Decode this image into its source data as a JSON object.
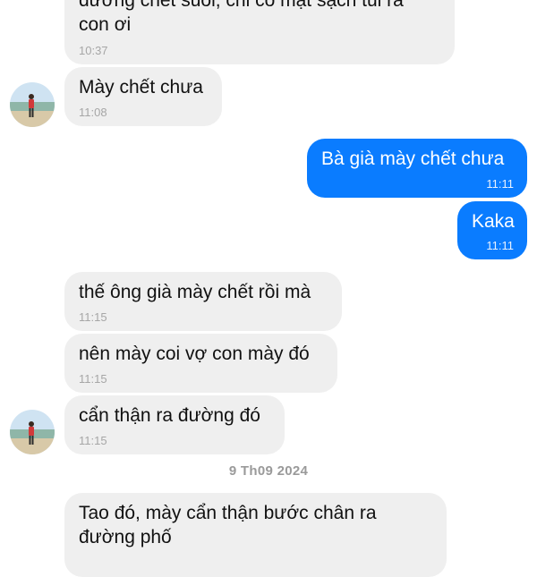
{
  "messages": [
    {
      "id": "m1",
      "side": "incoming",
      "lines": [
        "đường chết suối, chỉ có mặt sạch tui ra",
        "con ơi"
      ],
      "time": "10:37"
    },
    {
      "id": "m2",
      "side": "incoming",
      "lines": [
        "Mày chết chưa"
      ],
      "time": "11:08"
    },
    {
      "id": "m3",
      "side": "outgoing",
      "lines": [
        "Bà già mày chết chưa"
      ],
      "time": "11:11"
    },
    {
      "id": "m4",
      "side": "outgoing",
      "lines": [
        "Kaka"
      ],
      "time": "11:11"
    },
    {
      "id": "m5",
      "side": "incoming",
      "lines": [
        "thế ông già mày chết rồi mà"
      ],
      "time": "11:15"
    },
    {
      "id": "m6",
      "side": "incoming",
      "lines": [
        "nên mày coi vợ con mày đó"
      ],
      "time": "11:15"
    },
    {
      "id": "m7",
      "side": "incoming",
      "lines": [
        "cẩn thận ra đường đó"
      ],
      "time": "11:15"
    },
    {
      "id": "m8",
      "side": "incoming",
      "lines": [
        "Tao đó, mày cẩn thận bước chân ra",
        "đường phố"
      ],
      "time": ""
    }
  ],
  "date_separator": "9 Th09 2024",
  "colors": {
    "incoming_bubble": "#efefef",
    "outgoing_bubble": "#0a7cff",
    "timestamp": "#a6a6a6"
  }
}
